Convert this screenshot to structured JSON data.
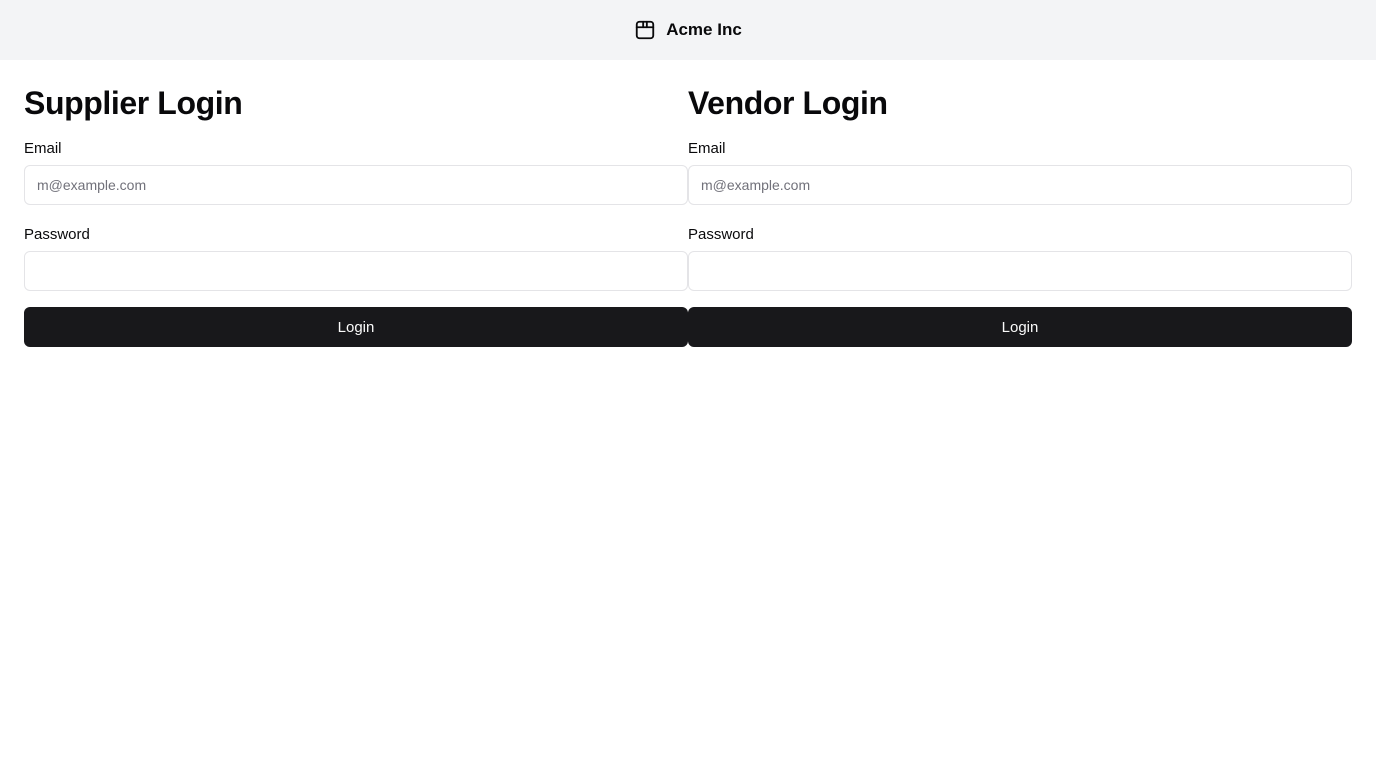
{
  "header": {
    "brand_icon": "package-icon",
    "brand_name": "Acme Inc",
    "background": "#f3f4f6"
  },
  "supplier": {
    "title": "Supplier Login",
    "email_label": "Email",
    "email_placeholder": "m@example.com",
    "email_value": "",
    "password_label": "Password",
    "password_value": "",
    "button_label": "Login"
  },
  "vendor": {
    "title": "Vendor Login",
    "email_label": "Email",
    "email_placeholder": "m@example.com",
    "email_value": "",
    "password_label": "Password",
    "password_value": "",
    "button_label": "Login"
  },
  "colors": {
    "button_bg": "#18181b",
    "input_border": "#e4e4e7",
    "text": "#09090b"
  }
}
